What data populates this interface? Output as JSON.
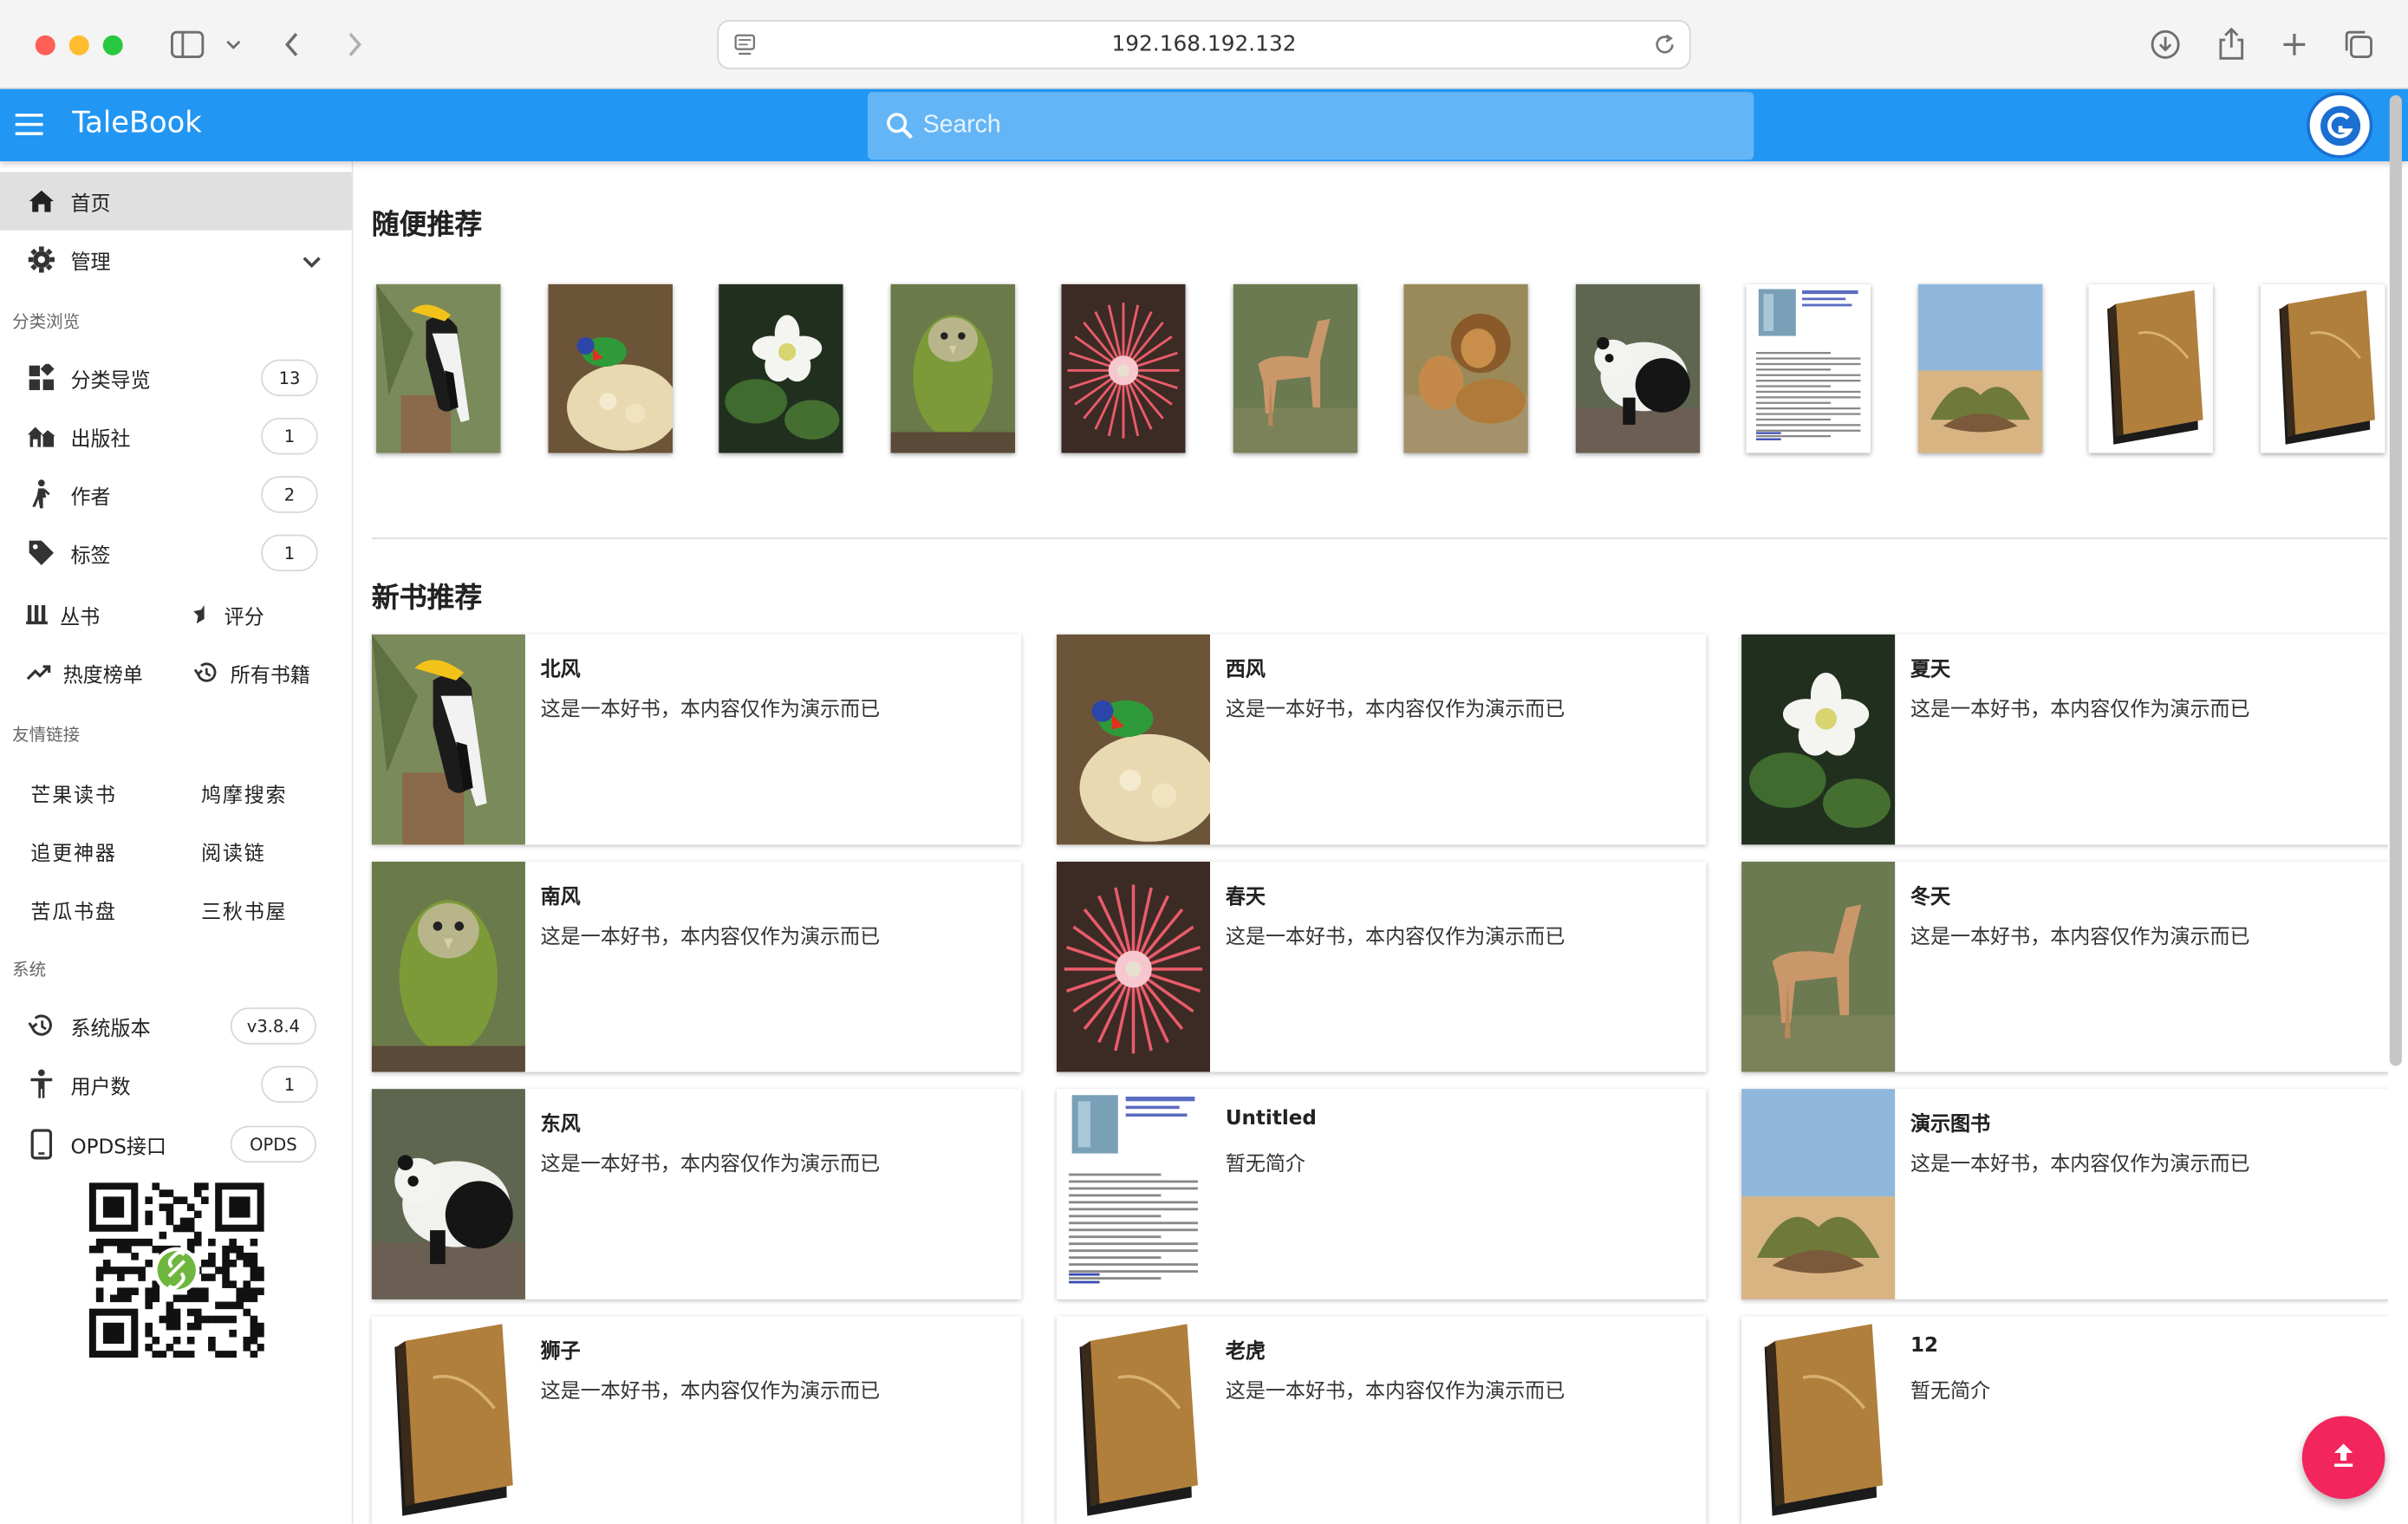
{
  "browser": {
    "url": "192.168.192.132"
  },
  "app": {
    "title": "TaleBook",
    "search_placeholder": "Search"
  },
  "sidebar": {
    "home": "首页",
    "manage": "管理",
    "browse_header": "分类浏览",
    "categories": [
      {
        "label": "分类导览",
        "count": "13",
        "icon": "grid-icon"
      },
      {
        "label": "出版社",
        "count": "1",
        "icon": "home-group-icon"
      },
      {
        "label": "作者",
        "count": "2",
        "icon": "person-walk-icon"
      },
      {
        "label": "标签",
        "count": "1",
        "icon": "tag-icon"
      }
    ],
    "series": "丛书",
    "rating": "评分",
    "hot": "热度榜单",
    "all_books": "所有书籍",
    "links_header": "友情链接",
    "links": [
      "芒果读书",
      "鸠摩搜索",
      "追更神器",
      "阅读链",
      "苦瓜书盘",
      "三秋书屋"
    ],
    "system_header": "系统",
    "system": [
      {
        "label": "系统版本",
        "value": "v3.8.4",
        "icon": "history-icon"
      },
      {
        "label": "用户数",
        "value": "1",
        "icon": "person-icon"
      },
      {
        "label": "OPDS接口",
        "value": "OPDS",
        "icon": "phone-icon"
      }
    ]
  },
  "main": {
    "random_title": "随便推荐",
    "random_books": [
      "hornbill",
      "lorikeet",
      "white-flower",
      "kakapo",
      "sundew",
      "deer",
      "lion",
      "panda",
      "document",
      "welwitschia",
      "brown-book",
      "brown-book"
    ],
    "new_title": "新书推荐",
    "new_books": [
      {
        "title": "北风",
        "desc": "这是一本好书，本内容仅作为演示而已",
        "cover": "hornbill"
      },
      {
        "title": "西风",
        "desc": "这是一本好书，本内容仅作为演示而已",
        "cover": "lorikeet"
      },
      {
        "title": "夏天",
        "desc": "这是一本好书，本内容仅作为演示而已",
        "cover": "white-flower"
      },
      {
        "title": "南风",
        "desc": "这是一本好书，本内容仅作为演示而已",
        "cover": "kakapo"
      },
      {
        "title": "春天",
        "desc": "这是一本好书，本内容仅作为演示而已",
        "cover": "sundew"
      },
      {
        "title": "冬天",
        "desc": "这是一本好书，本内容仅作为演示而已",
        "cover": "deer"
      },
      {
        "title": "东风",
        "desc": "这是一本好书，本内容仅作为演示而已",
        "cover": "panda"
      },
      {
        "title": "Untitled",
        "desc": "暂无简介",
        "cover": "document"
      },
      {
        "title": "演示图书",
        "desc": "这是一本好书，本内容仅作为演示而已",
        "cover": "welwitschia"
      },
      {
        "title": "狮子",
        "desc": "这是一本好书，本内容仅作为演示而已",
        "cover": "brown-book"
      },
      {
        "title": "老虎",
        "desc": "这是一本好书，本内容仅作为演示而已",
        "cover": "brown-book"
      },
      {
        "title": "12",
        "desc": "暂无简介",
        "cover": "brown-book"
      }
    ]
  },
  "colors": {
    "appbar": "#2196f3",
    "search": "#64b5f6",
    "fab": "#f2265c"
  }
}
